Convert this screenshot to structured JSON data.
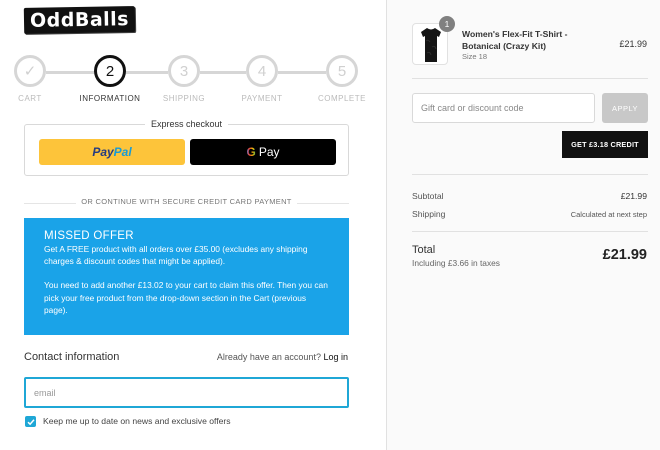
{
  "brand": {
    "logo_text": "OddBalls"
  },
  "stepper": {
    "steps": [
      {
        "number": "✓",
        "label": "CART"
      },
      {
        "number": "2",
        "label": "INFORMATION"
      },
      {
        "number": "3",
        "label": "SHIPPING"
      },
      {
        "number": "4",
        "label": "PAYMENT"
      },
      {
        "number": "5",
        "label": "COMPLETE"
      }
    ],
    "active_step": 2
  },
  "express_checkout": {
    "title": "Express checkout",
    "paypal_pay": "Pay",
    "paypal_pal": "Pal",
    "gpay_g": "G",
    "gpay_label": "Pay"
  },
  "divider_text": "OR CONTINUE WITH SECURE CREDIT CARD PAYMENT",
  "offer": {
    "heading": "MISSED OFFER",
    "paragraph1": "Get A FREE product with all orders over £35.00 (excludes any shipping charges & discount codes that might be applied).",
    "paragraph2": "You need to add another £13.02 to your cart to claim this offer. Then you can pick your free product from the drop-down section in the Cart (previous page)."
  },
  "contact": {
    "title": "Contact information",
    "account_prompt": "Already have an account?",
    "login_link": "Log in",
    "email_placeholder": "email",
    "newsletter_label": "Keep me up to date on news and exclusive offers",
    "newsletter_checked": true
  },
  "order": {
    "item": {
      "name": "Women's Flex-Fit T-Shirt - Botanical (Crazy Kit)",
      "variant": "Size 18",
      "quantity": "1",
      "price": "£21.99"
    },
    "discount_placeholder": "Gift card or discount code",
    "apply_label": "APPLY",
    "credit_button": "GET £3.18 CREDIT",
    "subtotal_label": "Subtotal",
    "subtotal_value": "£21.99",
    "shipping_label": "Shipping",
    "shipping_value": "Calculated at next step",
    "total_label": "Total",
    "tax_note": "Including £3.66 in taxes",
    "total_value": "£21.99"
  },
  "colors": {
    "accent": "#1fa7d6",
    "offer_bg": "#1aa3e8",
    "paypal_bg": "#fdc43a"
  }
}
